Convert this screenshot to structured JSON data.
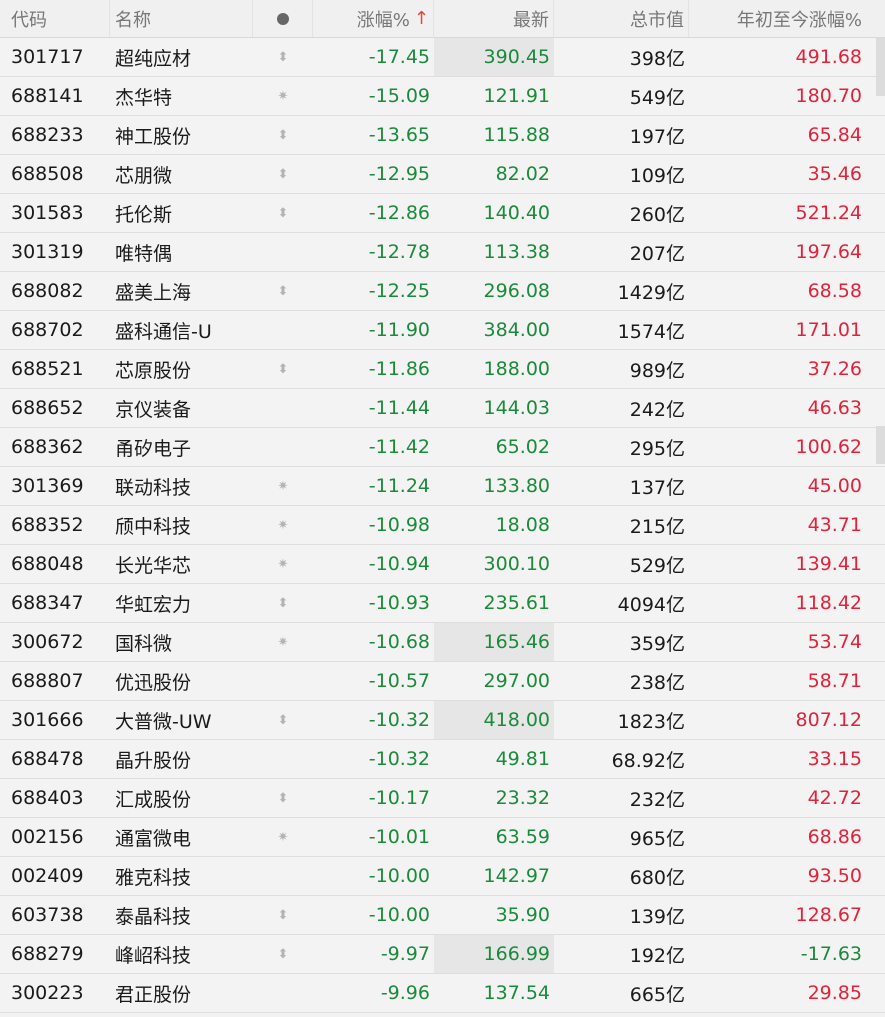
{
  "header": {
    "code": "代码",
    "name": "名称",
    "change": "涨幅%",
    "sort_icon": "arrow-up-icon",
    "last": "最新",
    "market_cap": "总市值",
    "ytd": "年初至今涨幅%"
  },
  "colors": {
    "down": "#1b8a3a",
    "up": "#e0233a",
    "sort_arrow": "#e8453c"
  },
  "rows": [
    {
      "code": "301717",
      "name": "超纯应材",
      "mark": "updown",
      "change": "-17.45",
      "last": "390.45",
      "last_hl": true,
      "cap": "398亿",
      "ytd": "491.68",
      "ytd_dir": "up"
    },
    {
      "code": "688141",
      "name": "杰华特",
      "mark": "star",
      "change": "-15.09",
      "last": "121.91",
      "last_hl": false,
      "cap": "549亿",
      "ytd": "180.70",
      "ytd_dir": "up"
    },
    {
      "code": "688233",
      "name": "神工股份",
      "mark": "updown",
      "change": "-13.65",
      "last": "115.88",
      "last_hl": false,
      "cap": "197亿",
      "ytd": "65.84",
      "ytd_dir": "up"
    },
    {
      "code": "688508",
      "name": "芯朋微",
      "mark": "updown",
      "change": "-12.95",
      "last": "82.02",
      "last_hl": false,
      "cap": "109亿",
      "ytd": "35.46",
      "ytd_dir": "up"
    },
    {
      "code": "301583",
      "name": "托伦斯",
      "mark": "updown",
      "change": "-12.86",
      "last": "140.40",
      "last_hl": false,
      "cap": "260亿",
      "ytd": "521.24",
      "ytd_dir": "up"
    },
    {
      "code": "301319",
      "name": "唯特偶",
      "mark": "",
      "change": "-12.78",
      "last": "113.38",
      "last_hl": false,
      "cap": "207亿",
      "ytd": "197.64",
      "ytd_dir": "up"
    },
    {
      "code": "688082",
      "name": "盛美上海",
      "mark": "updown",
      "change": "-12.25",
      "last": "296.08",
      "last_hl": false,
      "cap": "1429亿",
      "ytd": "68.58",
      "ytd_dir": "up"
    },
    {
      "code": "688702",
      "name": "盛科通信-U",
      "mark": "",
      "change": "-11.90",
      "last": "384.00",
      "last_hl": false,
      "cap": "1574亿",
      "ytd": "171.01",
      "ytd_dir": "up"
    },
    {
      "code": "688521",
      "name": "芯原股份",
      "mark": "updown",
      "change": "-11.86",
      "last": "188.00",
      "last_hl": false,
      "cap": "989亿",
      "ytd": "37.26",
      "ytd_dir": "up"
    },
    {
      "code": "688652",
      "name": "京仪装备",
      "mark": "",
      "change": "-11.44",
      "last": "144.03",
      "last_hl": false,
      "cap": "242亿",
      "ytd": "46.63",
      "ytd_dir": "up"
    },
    {
      "code": "688362",
      "name": "甬矽电子",
      "mark": "",
      "change": "-11.42",
      "last": "65.02",
      "last_hl": false,
      "cap": "295亿",
      "ytd": "100.62",
      "ytd_dir": "up"
    },
    {
      "code": "301369",
      "name": "联动科技",
      "mark": "star",
      "change": "-11.24",
      "last": "133.80",
      "last_hl": false,
      "cap": "137亿",
      "ytd": "45.00",
      "ytd_dir": "up"
    },
    {
      "code": "688352",
      "name": "颀中科技",
      "mark": "star",
      "change": "-10.98",
      "last": "18.08",
      "last_hl": false,
      "cap": "215亿",
      "ytd": "43.71",
      "ytd_dir": "up"
    },
    {
      "code": "688048",
      "name": "长光华芯",
      "mark": "star",
      "change": "-10.94",
      "last": "300.10",
      "last_hl": false,
      "cap": "529亿",
      "ytd": "139.41",
      "ytd_dir": "up"
    },
    {
      "code": "688347",
      "name": "华虹宏力",
      "mark": "updown",
      "change": "-10.93",
      "last": "235.61",
      "last_hl": false,
      "cap": "4094亿",
      "ytd": "118.42",
      "ytd_dir": "up"
    },
    {
      "code": "300672",
      "name": "国科微",
      "mark": "star",
      "change": "-10.68",
      "last": "165.46",
      "last_hl": true,
      "cap": "359亿",
      "ytd": "53.74",
      "ytd_dir": "up"
    },
    {
      "code": "688807",
      "name": "优迅股份",
      "mark": "",
      "change": "-10.57",
      "last": "297.00",
      "last_hl": false,
      "cap": "238亿",
      "ytd": "58.71",
      "ytd_dir": "up"
    },
    {
      "code": "301666",
      "name": "大普微-UW",
      "mark": "updown",
      "change": "-10.32",
      "last": "418.00",
      "last_hl": true,
      "cap": "1823亿",
      "ytd": "807.12",
      "ytd_dir": "up"
    },
    {
      "code": "688478",
      "name": "晶升股份",
      "mark": "",
      "change": "-10.32",
      "last": "49.81",
      "last_hl": false,
      "cap": "68.92亿",
      "ytd": "33.15",
      "ytd_dir": "up"
    },
    {
      "code": "688403",
      "name": "汇成股份",
      "mark": "updown",
      "change": "-10.17",
      "last": "23.32",
      "last_hl": false,
      "cap": "232亿",
      "ytd": "42.72",
      "ytd_dir": "up"
    },
    {
      "code": "002156",
      "name": "通富微电",
      "mark": "star",
      "change": "-10.01",
      "last": "63.59",
      "last_hl": false,
      "cap": "965亿",
      "ytd": "68.86",
      "ytd_dir": "up"
    },
    {
      "code": "002409",
      "name": "雅克科技",
      "mark": "",
      "change": "-10.00",
      "last": "142.97",
      "last_hl": false,
      "cap": "680亿",
      "ytd": "93.50",
      "ytd_dir": "up"
    },
    {
      "code": "603738",
      "name": "泰晶科技",
      "mark": "updown",
      "change": "-10.00",
      "last": "35.90",
      "last_hl": false,
      "cap": "139亿",
      "ytd": "128.67",
      "ytd_dir": "up"
    },
    {
      "code": "688279",
      "name": "峰岹科技",
      "mark": "updown",
      "change": "-9.97",
      "last": "166.99",
      "last_hl": true,
      "cap": "192亿",
      "ytd": "-17.63",
      "ytd_dir": "down"
    },
    {
      "code": "300223",
      "name": "君正股份",
      "mark": "",
      "change": "-9.96",
      "last": "137.54",
      "last_hl": false,
      "cap": "665亿",
      "ytd": "29.85",
      "ytd_dir": "up"
    }
  ]
}
